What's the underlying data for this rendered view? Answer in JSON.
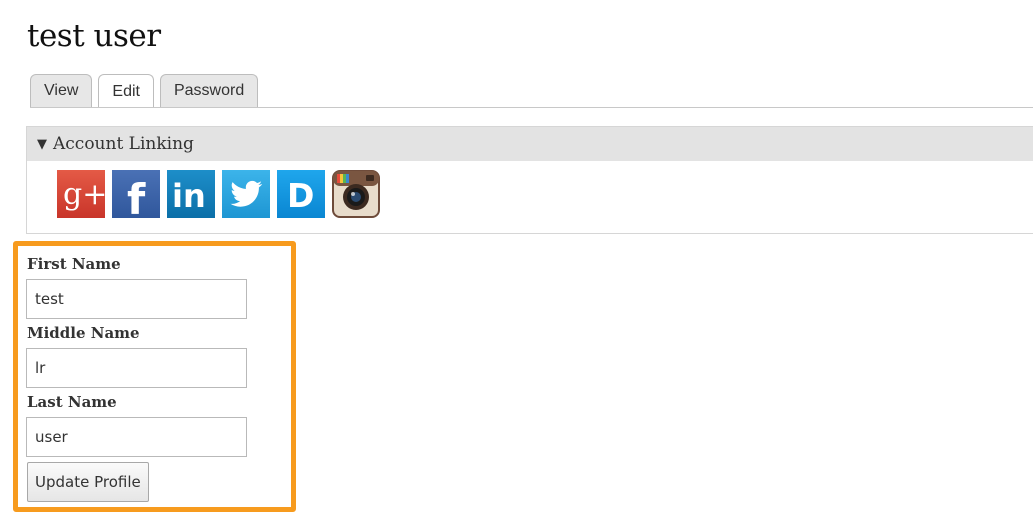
{
  "page_title": "test user",
  "tabs": [
    {
      "label": "View",
      "active": false
    },
    {
      "label": "Edit",
      "active": true
    },
    {
      "label": "Password",
      "active": false
    }
  ],
  "account_linking": {
    "legend": "Account Linking",
    "providers": [
      {
        "name": "Google+",
        "icon": "google-plus-icon",
        "glyph": "g+",
        "color": "#d8432f"
      },
      {
        "name": "Facebook",
        "icon": "facebook-icon",
        "glyph": "f",
        "color": "#3b5fa8"
      },
      {
        "name": "LinkedIn",
        "icon": "linkedin-icon",
        "glyph": "in",
        "color": "#1380bd"
      },
      {
        "name": "Twitter",
        "icon": "twitter-icon",
        "color": "#2aa5df"
      },
      {
        "name": "Disqus",
        "icon": "disqus-icon",
        "glyph": "D",
        "color": "#1496e0"
      },
      {
        "name": "Instagram",
        "icon": "instagram-icon",
        "color": "#6e4b3a"
      }
    ]
  },
  "form": {
    "first_name": {
      "label": "First Name",
      "value": "test"
    },
    "middle_name": {
      "label": "Middle Name",
      "value": "lr"
    },
    "last_name": {
      "label": "Last Name",
      "value": "user"
    },
    "submit_label": "Update Profile"
  },
  "highlight_color": "#f79b1e"
}
